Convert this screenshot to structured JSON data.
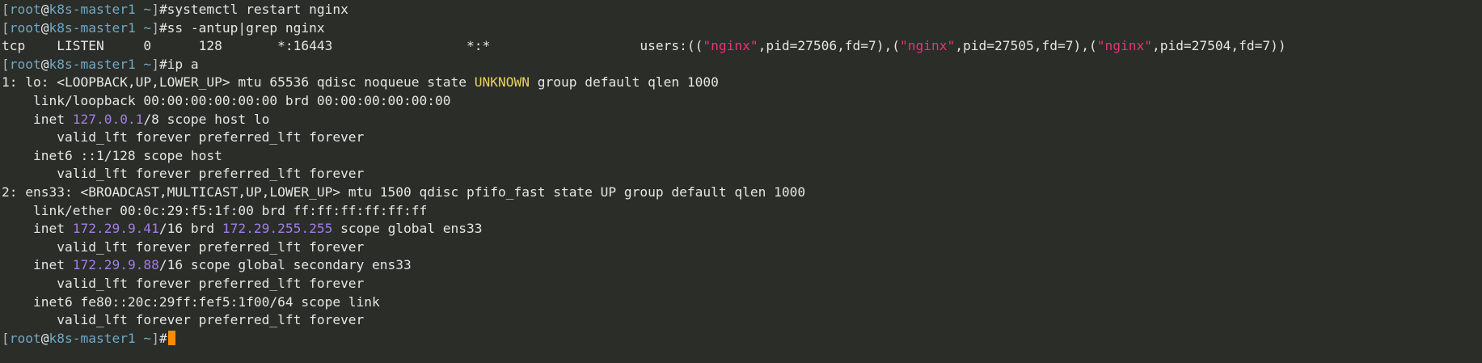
{
  "terminal": {
    "lines": [
      [
        [
          "[",
          "bracket"
        ],
        [
          "root",
          "user"
        ],
        [
          "@",
          "at"
        ],
        [
          "k8s-master1",
          "host"
        ],
        [
          " ~",
          "path"
        ],
        [
          "]",
          "bracket"
        ],
        [
          "#systemctl restart nginx",
          "plain"
        ]
      ],
      [
        [
          "[",
          "bracket"
        ],
        [
          "root",
          "user"
        ],
        [
          "@",
          "at"
        ],
        [
          "k8s-master1",
          "host"
        ],
        [
          " ~",
          "path"
        ],
        [
          "]",
          "bracket"
        ],
        [
          "#ss -antup|grep nginx",
          "plain"
        ]
      ],
      [
        [
          "tcp    LISTEN     0      128       *:16443                 *:*                   users:((",
          "plain"
        ],
        [
          "\"nginx\"",
          "str"
        ],
        [
          ",pid=27506,fd=7),(",
          "plain"
        ],
        [
          "\"nginx\"",
          "str"
        ],
        [
          ",pid=27505,fd=7),(",
          "plain"
        ],
        [
          "\"nginx\"",
          "str"
        ],
        [
          ",pid=27504,fd=7))",
          "plain"
        ]
      ],
      [
        [
          "[",
          "bracket"
        ],
        [
          "root",
          "user"
        ],
        [
          "@",
          "at"
        ],
        [
          "k8s-master1",
          "host"
        ],
        [
          " ~",
          "path"
        ],
        [
          "]",
          "bracket"
        ],
        [
          "#ip a",
          "plain"
        ]
      ],
      [
        [
          "1: lo: <LOOPBACK,UP,LOWER_UP> mtu 65536 qdisc noqueue state ",
          "plain"
        ],
        [
          "UNKNOWN",
          "warn"
        ],
        [
          " group default qlen 1000",
          "plain"
        ]
      ],
      [
        [
          "    link/loopback 00:00:00:00:00:00 brd 00:00:00:00:00:00",
          "plain"
        ]
      ],
      [
        [
          "    inet ",
          "plain"
        ],
        [
          "127.0.0.1",
          "ip"
        ],
        [
          "/8 scope host lo",
          "plain"
        ]
      ],
      [
        [
          "       valid_lft forever preferred_lft forever",
          "plain"
        ]
      ],
      [
        [
          "    inet6 ::1/128 scope host",
          "plain"
        ]
      ],
      [
        [
          "       valid_lft forever preferred_lft forever",
          "plain"
        ]
      ],
      [
        [
          "2: ens33: <BROADCAST,MULTICAST,UP,LOWER_UP> mtu 1500 qdisc pfifo_fast state UP group default qlen 1000",
          "plain"
        ]
      ],
      [
        [
          "    link/ether 00:0c:29:f5:1f:00 brd ff:ff:ff:ff:ff:ff",
          "plain"
        ]
      ],
      [
        [
          "    inet ",
          "plain"
        ],
        [
          "172.29.9.41",
          "ip"
        ],
        [
          "/16 brd ",
          "plain"
        ],
        [
          "172.29.255.255",
          "ip"
        ],
        [
          " scope global ens33",
          "plain"
        ]
      ],
      [
        [
          "       valid_lft forever preferred_lft forever",
          "plain"
        ]
      ],
      [
        [
          "    inet ",
          "plain"
        ],
        [
          "172.29.9.88",
          "ip"
        ],
        [
          "/16 scope global secondary ens33",
          "plain"
        ]
      ],
      [
        [
          "       valid_lft forever preferred_lft forever",
          "plain"
        ]
      ],
      [
        [
          "    inet6 fe80::20c:29ff:fef5:1f00/64 scope link",
          "plain"
        ]
      ],
      [
        [
          "       valid_lft forever preferred_lft forever",
          "plain"
        ]
      ],
      [
        [
          "[",
          "bracket"
        ],
        [
          "root",
          "user"
        ],
        [
          "@",
          "at"
        ],
        [
          "k8s-master1",
          "host"
        ],
        [
          " ~",
          "path"
        ],
        [
          "]",
          "bracket"
        ],
        [
          "#",
          "plain"
        ]
      ]
    ]
  },
  "colors": {
    "background": "#2b2d28",
    "text": "#e6e6e6",
    "prompt": "#6fa8c7",
    "string": "#e4357a",
    "ip": "#a27ee6",
    "warning": "#e7d55f",
    "cursor": "#ff8c00"
  }
}
